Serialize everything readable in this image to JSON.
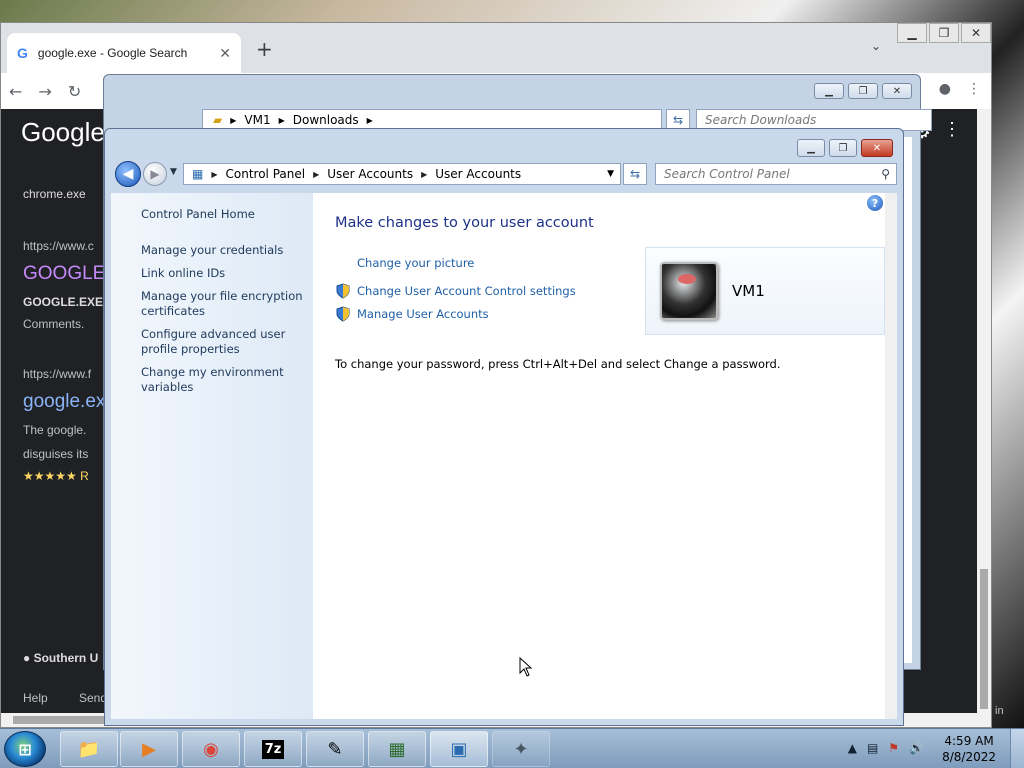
{
  "chrome": {
    "tab_title": "google.exe - Google Search",
    "tab_favicon": "G",
    "new_tab": "+",
    "tab_search": "⌄",
    "window_controls": [
      "▁",
      "❐",
      "✕"
    ],
    "nav": {
      "back": "←",
      "forward": "→",
      "reload": "↻"
    },
    "logo": "Google",
    "snippets": [
      {
        "text": "chrome.exe"
      },
      {
        "text": "https://www.c"
      },
      {
        "text": "GOOGLE"
      },
      {
        "text": "GOOGLE.EXE"
      },
      {
        "text": "Comments."
      },
      {
        "text": "https://www.f"
      },
      {
        "text": "google.ex"
      },
      {
        "text": "The google."
      },
      {
        "text": "disguises its"
      },
      {
        "text": "★★★★★ R"
      },
      {
        "text": "● Southern U"
      },
      {
        "text": "Help"
      },
      {
        "text": "Send"
      },
      {
        "text": "in"
      }
    ]
  },
  "explorer": {
    "breadcrumb": [
      "VM1",
      "Downloads"
    ],
    "search_placeholder": "Search Downloads",
    "window_controls": [
      "▁",
      "❐",
      "✕"
    ]
  },
  "control_panel": {
    "window_controls": [
      "▁",
      "❐",
      "✕"
    ],
    "breadcrumb": [
      "Control Panel",
      "User Accounts",
      "User Accounts"
    ],
    "search_placeholder": "Search Control Panel",
    "sidebar": {
      "home": "Control Panel Home",
      "links": [
        "Manage your credentials",
        "Link online IDs",
        "Manage your file encryption certificates",
        "Configure advanced user profile properties",
        "Change my environment variables"
      ]
    },
    "main": {
      "title": "Make changes to your user account",
      "tasks": [
        {
          "label": "Change your picture",
          "shield": false
        },
        {
          "label": "Change User Account Control settings",
          "shield": true
        },
        {
          "label": "Manage User Accounts",
          "shield": true
        }
      ],
      "note": "To change your password, press Ctrl+Alt+Del and select Change a password.",
      "user_name": "VM1"
    }
  },
  "taskbar": {
    "time": "4:59 AM",
    "date": "8/8/2022",
    "apps": [
      {
        "name": "file-explorer",
        "glyph": "📁"
      },
      {
        "name": "media-player",
        "glyph": "▶"
      },
      {
        "name": "chrome",
        "glyph": "◉"
      },
      {
        "name": "7zip",
        "glyph": "7z"
      },
      {
        "name": "notepad",
        "glyph": "✎"
      },
      {
        "name": "terminal",
        "glyph": "▦"
      },
      {
        "name": "control-panel",
        "glyph": "▣"
      },
      {
        "name": "unknown-app",
        "glyph": "✦"
      }
    ]
  }
}
